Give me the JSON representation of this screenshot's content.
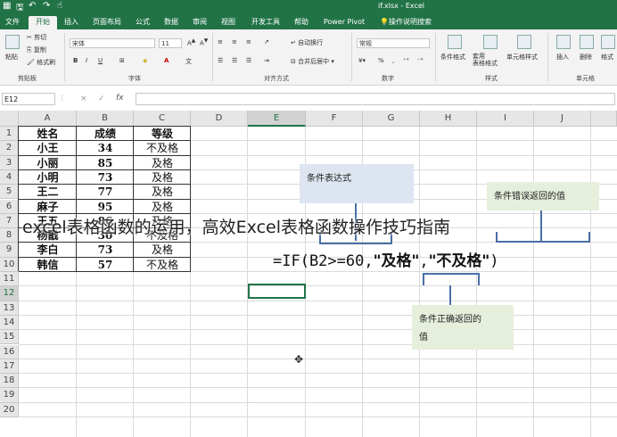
{
  "window": {
    "title": "if.xlsx  -  Excel",
    "quick_access": [
      "save-icon",
      "undo-icon",
      "redo-icon",
      "touch-icon"
    ]
  },
  "tabs": [
    {
      "label": "文件",
      "active": false
    },
    {
      "label": "开始",
      "active": true
    },
    {
      "label": "插入",
      "active": false
    },
    {
      "label": "页面布局",
      "active": false
    },
    {
      "label": "公式",
      "active": false
    },
    {
      "label": "数据",
      "active": false
    },
    {
      "label": "审阅",
      "active": false
    },
    {
      "label": "视图",
      "active": false
    },
    {
      "label": "开发工具",
      "active": false
    },
    {
      "label": "帮助",
      "active": false
    },
    {
      "label": "Power Pivot",
      "active": false
    },
    {
      "label": "操作说明搜索",
      "active": false
    }
  ],
  "ribbon": {
    "clipboard": {
      "paste": "粘贴",
      "cut": "剪切",
      "copy": "复制",
      "format_painter": "格式刷",
      "label": "剪贴板"
    },
    "font": {
      "name": "宋体",
      "size": "11",
      "label": "字体",
      "bold": "B",
      "italic": "I",
      "underline": "U",
      "color_letter": "A"
    },
    "alignment": {
      "wrap": "自动换行",
      "merge": "合并后居中",
      "label": "对齐方式"
    },
    "number": {
      "format": "常规",
      "percent": "%",
      "label": "数字"
    },
    "styles": {
      "conditional": "条件格式",
      "table": "套用\n表格格式",
      "cell_styles": "单元格样式",
      "label": "样式"
    },
    "cells": {
      "insert": "插入",
      "delete": "删除",
      "format": "格式",
      "label": "单元格"
    }
  },
  "formula_bar": {
    "name_box": "E12",
    "cancel": "×",
    "enter": "✓",
    "fx": "fx",
    "value": ""
  },
  "columns": [
    "A",
    "B",
    "C",
    "D",
    "E",
    "F",
    "G",
    "H",
    "I",
    "J"
  ],
  "selected_column": "E",
  "rows": [
    "1",
    "2",
    "3",
    "4",
    "5",
    "6",
    "7",
    "8",
    "9",
    "10",
    "11",
    "12",
    "13",
    "14",
    "15",
    "16",
    "17",
    "18",
    "19",
    "20"
  ],
  "selected_row": "12",
  "table": {
    "headers": [
      "姓名",
      "成绩",
      "等级"
    ],
    "rows": [
      [
        "小王",
        "34",
        "不及格"
      ],
      [
        "小丽",
        "85",
        "及格"
      ],
      [
        "小明",
        "73",
        "及格"
      ],
      [
        "王二",
        "77",
        "及格"
      ],
      [
        "麻子",
        "95",
        "及格"
      ],
      [
        "王五",
        "86",
        "及格"
      ],
      [
        "杨戬",
        "30",
        "不及格"
      ],
      [
        "李白",
        "73",
        "及格"
      ],
      [
        "韩信",
        "57",
        "不及格"
      ]
    ]
  },
  "annotations": {
    "condition": "条件表达式",
    "false_value": "条件错误返回的值",
    "true_value": "条件正确返回的\n值",
    "formula_prefix": "=IF(B2>=60,",
    "formula_true": "\"及格\"",
    "formula_comma": ",",
    "formula_false": "\"不及格\"",
    "formula_suffix": ")"
  },
  "overlay_text": "excel表格函数的运用，高效Excel表格函数操作技巧指南"
}
